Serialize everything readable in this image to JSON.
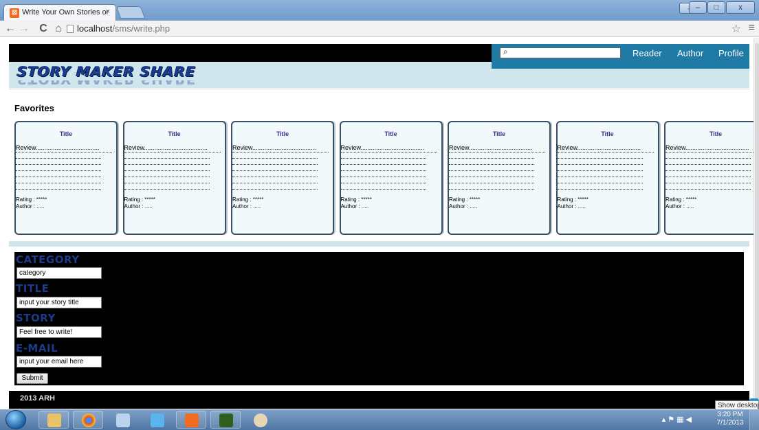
{
  "browser": {
    "tab_title": "Write Your Own Stories or",
    "tab_close": "×",
    "favicon": "⊠",
    "url_host": "localhost",
    "url_path": "/sms/write.php",
    "back": "←",
    "forward": "→",
    "reload": "C",
    "home": "⌂",
    "star": "☆",
    "menu": "≡",
    "win_min": "–",
    "win_max": "□",
    "win_close": "x"
  },
  "site": {
    "logo": "STORY MAKER SHARE",
    "search_icon": "⌕",
    "search_value": "",
    "nav": [
      "Reader",
      "Author",
      "Profile"
    ]
  },
  "favorites": {
    "heading": "Favorites",
    "cards": [
      {
        "title": "Title",
        "review": "Review.....................................",
        "rating": "Rating : *****",
        "author": "Author : ....."
      },
      {
        "title": "Title",
        "review": "Review.....................................",
        "rating": "Rating : *****",
        "author": "Author : ....."
      },
      {
        "title": "Title",
        "review": "Review.....................................",
        "rating": "Rating : *****",
        "author": "Author : ....."
      },
      {
        "title": "Title",
        "review": "Review.....................................",
        "rating": "Rating : *****",
        "author": "Author : ....."
      },
      {
        "title": "Title",
        "review": "Review.....................................",
        "rating": "Rating : *****",
        "author": "Author : ....."
      },
      {
        "title": "Title",
        "review": "Review.....................................",
        "rating": "Rating : *****",
        "author": "Author : ....."
      },
      {
        "title": "Title",
        "review": "Review.....................................",
        "rating": "Rating : *****",
        "author": "Author : ....."
      }
    ]
  },
  "form": {
    "category_label": "CATEGORY",
    "category_value": "category",
    "title_label": "TITLE",
    "title_value": "input your story title",
    "story_label": "STORY",
    "story_value": "Feel free to write!",
    "email_label": "E-MAIL",
    "email_value": "input your email here",
    "submit_label": "Submit"
  },
  "footer": {
    "text": "2013 ARH"
  },
  "overlay": {
    "tooltip": "Show desktop",
    "skype": "S"
  },
  "taskbar": {
    "clock_time": "3:20 PM",
    "clock_date": "7/1/2013",
    "tray_icons": "▴ ⚑ ▦ ◀"
  },
  "colors": {
    "nav_blue": "#1f7aa5",
    "header_light": "#cfe7ec",
    "label_blue": "#1a3c8a",
    "card_bg": "#f2f9fb"
  }
}
